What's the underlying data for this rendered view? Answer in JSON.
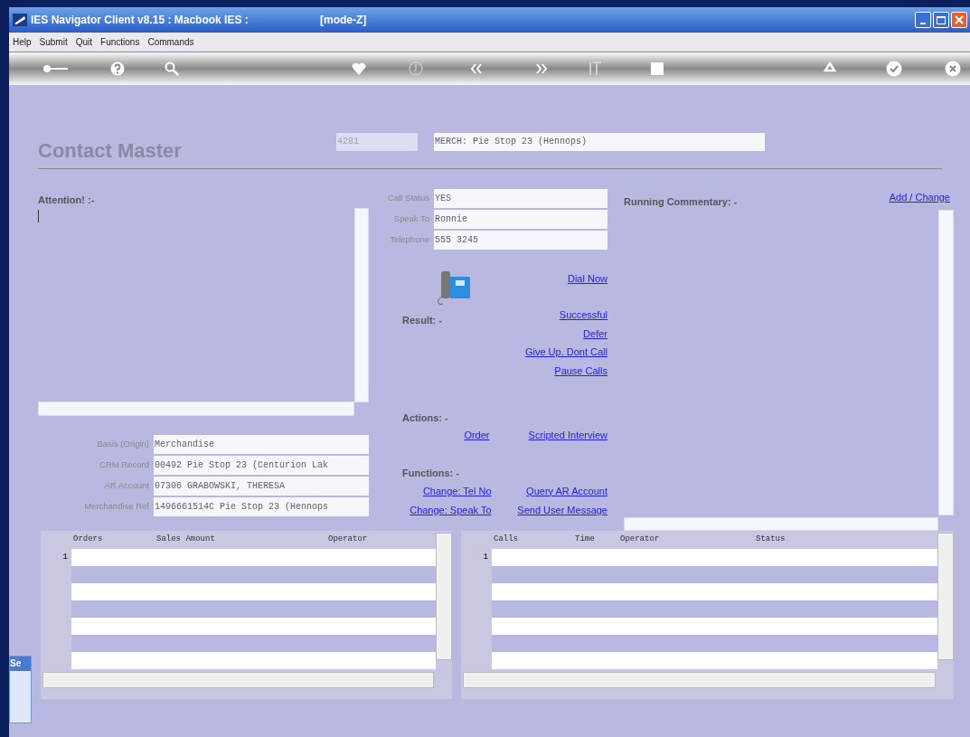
{
  "window": {
    "title": "IES Navigator Client v8.15 : Macbook IES :",
    "mode": "[mode-Z]"
  },
  "menu": [
    "Help",
    "Submit",
    "Quit",
    "Functions",
    "Commands"
  ],
  "header": {
    "title": "Contact Master",
    "code": "4281",
    "name": "MERCH: Pie Stop 23 (Hennops)"
  },
  "attention": {
    "label": "Attention! :-"
  },
  "call_fields": [
    {
      "label": "Call Status",
      "value": "YES"
    },
    {
      "label": "Speak To",
      "value": "Ronnie"
    },
    {
      "label": "Telephone",
      "value": "555 3245"
    }
  ],
  "dial_link": "Dial Now",
  "result": {
    "label": "Result: -",
    "links": [
      "Successful",
      "Defer",
      "Give Up. Dont Call",
      "Pause Calls"
    ]
  },
  "actions": {
    "label": "Actions: -",
    "links": [
      "Order",
      "Scripted Interview"
    ]
  },
  "functions": {
    "label": "Functions: -",
    "links": [
      "Change: Tel No",
      "Query AR Account",
      "Change: Speak To",
      "Send User Message"
    ]
  },
  "commentary": {
    "label": "Running Commentary: -",
    "link": "Add / Change"
  },
  "details": [
    {
      "label": "Basis (Origin)",
      "value": "Merchandise"
    },
    {
      "label": "CRM Record",
      "value": "00492 Pie Stop 23 (Centurion Lak"
    },
    {
      "label": "AR Account",
      "value": "07306 GRABOWSKI, THERESA"
    },
    {
      "label": "Merchandise Ref",
      "value": "1496661514C Pie Stop 23 (Hennops"
    }
  ],
  "orders_grid": {
    "columns": [
      "Orders",
      "Sales Amount",
      "Operator"
    ],
    "row_numbers": [
      "1"
    ]
  },
  "calls_grid": {
    "columns": [
      "Calls",
      "Time",
      "Operator",
      "Status"
    ],
    "row_numbers": [
      "1"
    ]
  },
  "side_tab": {
    "label": "Se"
  }
}
